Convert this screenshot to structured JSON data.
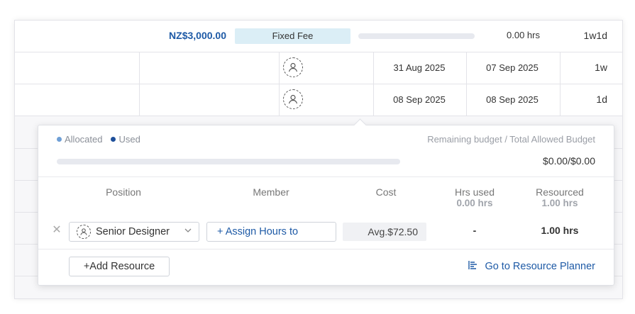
{
  "grid": {
    "summary_row": {
      "budget": "NZ$3,000.00",
      "fee_type": "Fixed Fee",
      "hours": "0.00 hrs",
      "duration": "1w1d"
    },
    "rows": [
      {
        "start": "31 Aug 2025",
        "end": "07 Sep 2025",
        "duration": "1w"
      },
      {
        "start": "08 Sep 2025",
        "end": "08 Sep 2025",
        "duration": "1d"
      }
    ]
  },
  "popover": {
    "legend": {
      "allocated": "Allocated",
      "used": "Used"
    },
    "legend_colors": {
      "allocated": "#6f9fd6",
      "used": "#1e4f9a"
    },
    "remaining_label": "Remaining budget / Total Allowed Budget",
    "amount": "$0.00/$0.00",
    "columns": {
      "position": "Position",
      "member": "Member",
      "cost": "Cost",
      "hrs_used": "Hrs used",
      "hrs_used_sub": "0.00 hrs",
      "resourced": "Resourced",
      "resourced_sub": "1.00 hrs"
    },
    "resource_row": {
      "position": "Senior Designer",
      "member_placeholder": "+ Assign Hours to",
      "cost": "Avg.$72.50",
      "hrs_used": "-",
      "resourced": "1.00 hrs"
    },
    "add_resource": "+Add Resource",
    "planner_link": "Go to Resource Planner"
  }
}
